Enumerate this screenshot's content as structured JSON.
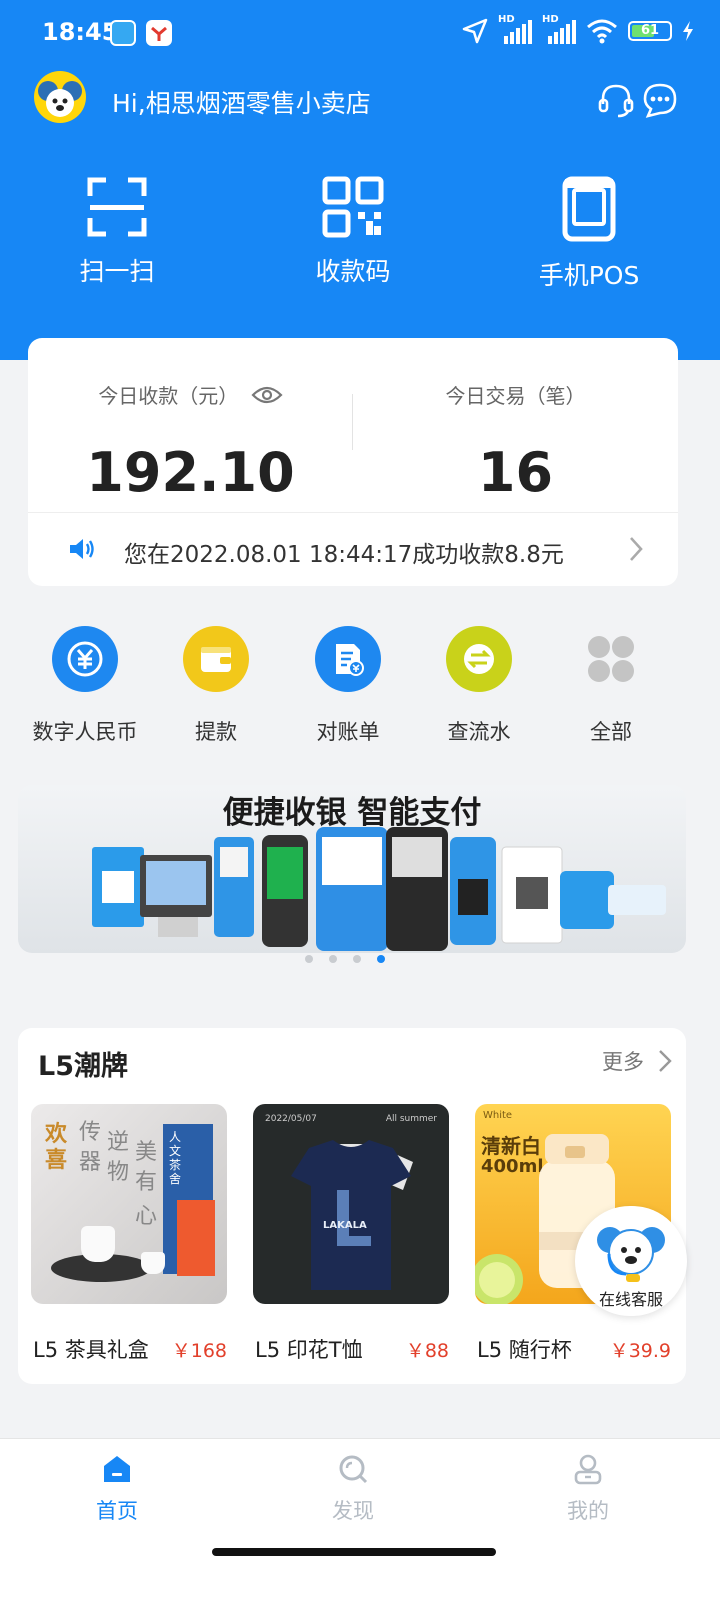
{
  "status_bar": {
    "time": "18:45",
    "network_label": "HD",
    "battery": "61",
    "icons": [
      "lakala-app-icon",
      "app-notification-icon",
      "location-icon",
      "signal-icon",
      "wifi-icon",
      "battery-icon",
      "charging-icon"
    ]
  },
  "header": {
    "greeting": "Hi,相思烟酒零售小卖店",
    "icons": [
      "headset-icon",
      "chat-icon"
    ]
  },
  "quick_actions": [
    {
      "label": "扫一扫",
      "icon": "scan-icon"
    },
    {
      "label": "收款码",
      "icon": "qr-code-icon"
    },
    {
      "label": "手机POS",
      "icon": "pos-terminal-icon"
    }
  ],
  "summary": {
    "today_receipt_label": "今日收款（元）",
    "today_receipt_value": "192.10",
    "today_txn_label": "今日交易（笔）",
    "today_txn_value": "16",
    "notice": "您在2022.08.01 18:44:17成功收款8.8元"
  },
  "services": [
    {
      "label": "数字人民币",
      "icon": "digital-rmb-icon",
      "color": "#1e88f0"
    },
    {
      "label": "提款",
      "icon": "wallet-icon",
      "color": "#f2c81a"
    },
    {
      "label": "对账单",
      "icon": "statement-icon",
      "color": "#1e88f0"
    },
    {
      "label": "查流水",
      "icon": "transfer-icon",
      "color": "#c9d21a"
    },
    {
      "label": "全部",
      "icon": "all-grid-icon",
      "color": "#c4c4c4"
    }
  ],
  "banner": {
    "title": "便捷收银 智能支付",
    "slides": 4,
    "active_slide": 4
  },
  "l5": {
    "title": "L5潮牌",
    "more": "更多",
    "products": [
      {
        "name": "L5 茶具礼盒",
        "price": "￥168",
        "image_text_1": "欢喜",
        "image_text_2": "传器",
        "image_text_3": "逆物",
        "image_text_4": "美有",
        "image_text_5": "心",
        "image_text_6": "人文茶舍"
      },
      {
        "name": "L5 印花T恤",
        "price": "￥88",
        "image_text_1": "LAKALA",
        "image_text_2": "2022/05/07",
        "image_text_3": "All summer"
      },
      {
        "name": "L5 随行杯",
        "price": "￥39.9",
        "image_text_1": "White",
        "image_text_2": "清新白",
        "image_text_3": "400ml"
      }
    ]
  },
  "floating_service": {
    "label": "在线客服"
  },
  "tabbar": [
    {
      "label": "首页",
      "icon": "home-icon",
      "active": true
    },
    {
      "label": "发现",
      "icon": "discover-icon",
      "active": false
    },
    {
      "label": "我的",
      "icon": "profile-icon",
      "active": false
    }
  ],
  "colors": {
    "brand": "#1787f5",
    "price": "#e2402b",
    "tab_inactive": "#b5bcc4"
  }
}
